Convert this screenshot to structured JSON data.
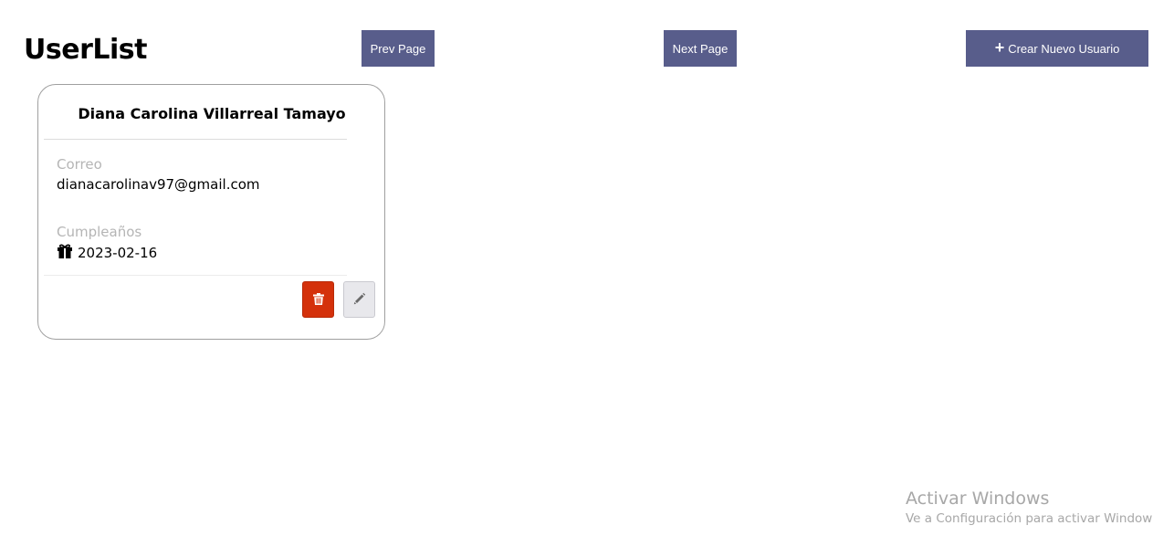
{
  "header": {
    "title": "UserList",
    "prev_label": "Prev Page",
    "next_label": "Next Page",
    "create_label": "Crear Nuevo Usuario",
    "create_icon": "plus-icon"
  },
  "users": [
    {
      "name": "Diana Carolina Villarreal Tamayo",
      "email_label": "Correo",
      "email": "dianacarolinav97@gmail.com",
      "birthday_label": "Cumpleaños",
      "birthday_icon": "gift-icon",
      "birthday": "2023-02-16",
      "delete_icon": "trash-icon",
      "edit_icon": "pencil-icon"
    }
  ],
  "colors": {
    "primary_button": "#585d8b",
    "delete_button": "#d4310b",
    "edit_button": "#e8e8ec"
  },
  "watermark": {
    "title": "Activar Windows",
    "subtitle": "Ve a Configuración para activar Windows"
  }
}
